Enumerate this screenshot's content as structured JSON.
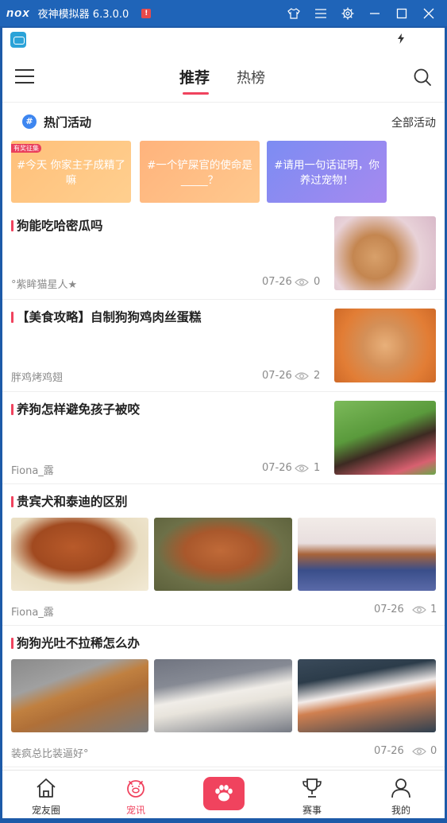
{
  "emulator": {
    "logo": "nox",
    "title": "夜神模拟器 6.3.0.0",
    "badge": "!"
  },
  "header": {
    "tabs": [
      {
        "label": "推荐",
        "active": true
      },
      {
        "label": "热榜",
        "active": false
      }
    ]
  },
  "hot_activities": {
    "title": "热门活动",
    "all_link": "全部活动",
    "cards": [
      {
        "tag": "有奖征集",
        "text": "#今天 你家主子成精了嘛"
      },
      {
        "tag": "",
        "text": "#一个铲屎官的使命是_____？"
      },
      {
        "tag": "",
        "text": "#请用一句话证明，你养过宠物！"
      }
    ]
  },
  "articles": [
    {
      "title": "狗能吃哈密瓜吗",
      "author": "°紫眸猫星人★",
      "date": "07-26",
      "views": "0"
    },
    {
      "title": "【美食攻略】自制狗狗鸡肉丝蛋糕",
      "author": "胖鸡烤鸡翅",
      "date": "07-26",
      "views": "2"
    },
    {
      "title": "养狗怎样避免孩子被咬",
      "author": "Fiona_露",
      "date": "07-26",
      "views": "1"
    },
    {
      "title": "贵宾犬和泰迪的区别",
      "author": "Fiona_露",
      "date": "07-26",
      "views": "1"
    },
    {
      "title": "狗狗光吐不拉稀怎么办",
      "author": "装疯总比装逼好°",
      "date": "07-26",
      "views": "0"
    }
  ],
  "bottom_nav": [
    {
      "label": "宠友圈",
      "icon": "home-icon",
      "active": false
    },
    {
      "label": "宠讯",
      "icon": "pig-face-icon",
      "active": true
    },
    {
      "label": "",
      "icon": "paw-icon",
      "active": false
    },
    {
      "label": "赛事",
      "icon": "trophy-icon",
      "active": false
    },
    {
      "label": "我的",
      "icon": "person-icon",
      "active": false
    }
  ],
  "colors": {
    "accent": "#f0435e",
    "emulator_bar": "#1f64b8"
  }
}
